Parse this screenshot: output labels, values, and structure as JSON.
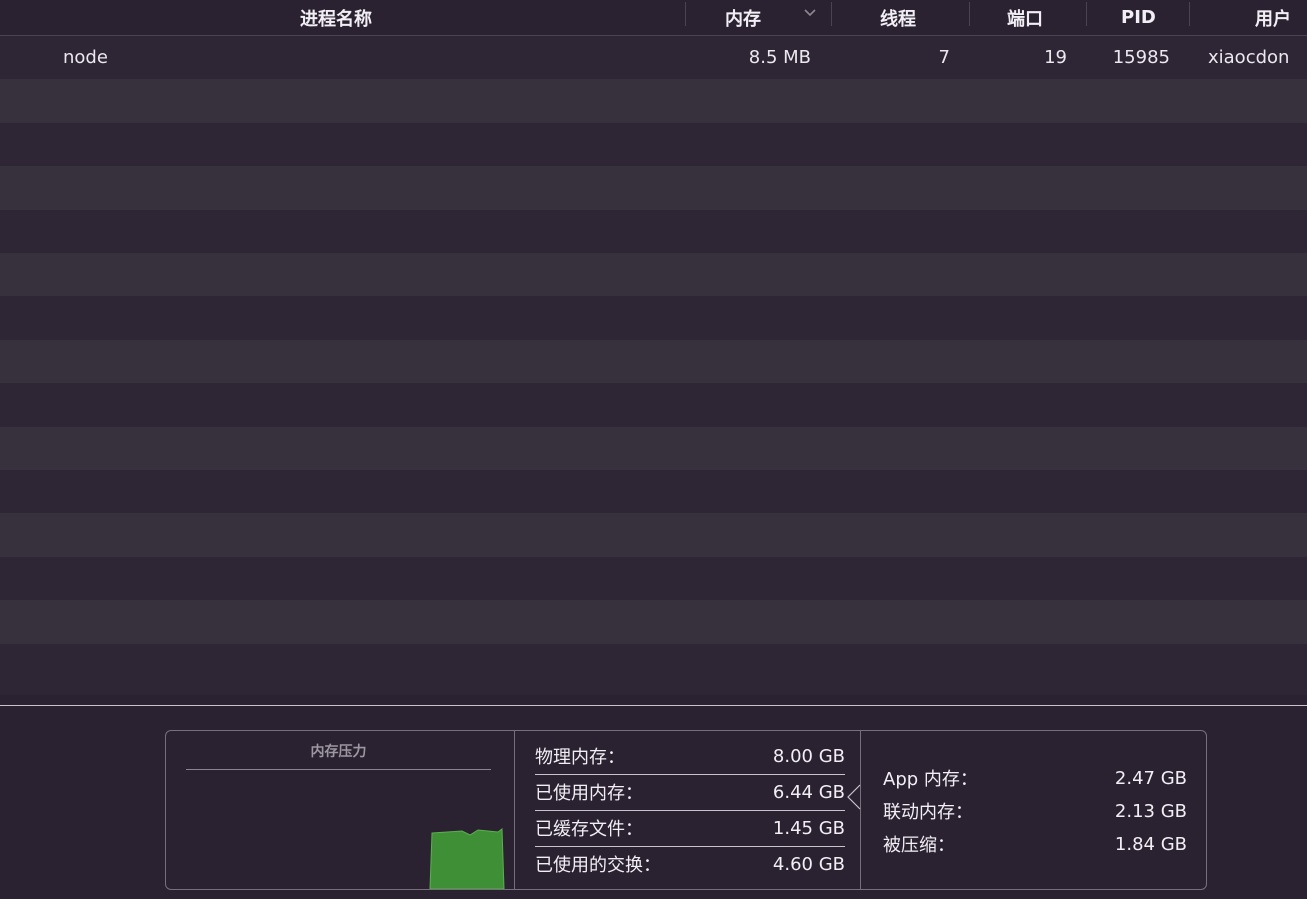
{
  "table": {
    "columns": {
      "name": "进程名称",
      "memory": "内存",
      "threads": "线程",
      "ports": "端口",
      "pid": "PID",
      "user": "用户"
    },
    "sort_icon": "chevron-down-icon",
    "rows": [
      {
        "name": "node",
        "memory": "8.5 MB",
        "threads": "7",
        "ports": "19",
        "pid": "15985",
        "user": "xiaocdon"
      }
    ]
  },
  "memory_pressure": {
    "title": "内存压力",
    "graph_color": "#3f8f36"
  },
  "stats_left": [
    {
      "label": "物理内存：",
      "value": "8.00 GB"
    },
    {
      "label": "已使用内存：",
      "value": "6.44 GB"
    },
    {
      "label": "已缓存文件：",
      "value": "1.45 GB"
    },
    {
      "label": "已使用的交换：",
      "value": "4.60 GB"
    }
  ],
  "stats_right": [
    {
      "label": "App 内存：",
      "value": "2.47 GB"
    },
    {
      "label": "联动内存：",
      "value": "2.13 GB"
    },
    {
      "label": "被压缩：",
      "value": "1.84 GB"
    }
  ]
}
